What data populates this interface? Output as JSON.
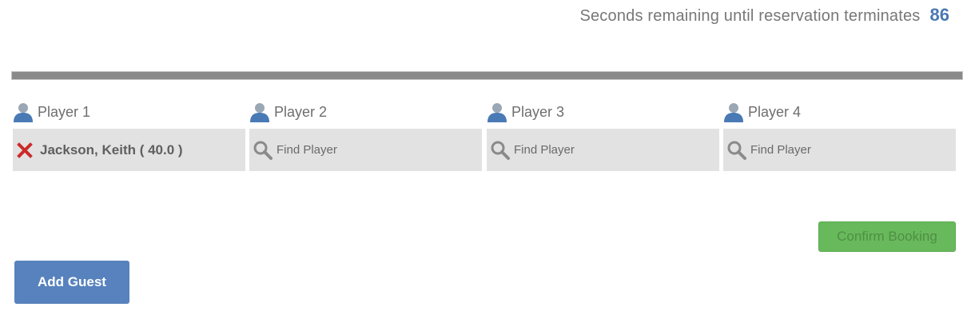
{
  "timer": {
    "label": "Seconds remaining until reservation terminates",
    "seconds": "86"
  },
  "progress": {
    "fraction_remaining": 1.0
  },
  "players": [
    {
      "label": "Player 1",
      "value": "Jackson, Keith ( 40.0 )"
    },
    {
      "label": "Player 2",
      "placeholder": "Find Player"
    },
    {
      "label": "Player 3",
      "placeholder": "Find Player"
    },
    {
      "label": "Player 4",
      "placeholder": "Find Player"
    }
  ],
  "buttons": {
    "confirm_label": "Confirm Booking",
    "add_guest_label": "Add Guest"
  },
  "colors": {
    "accent_blue": "#5782bd",
    "timer_blue": "#4a78b2",
    "confirm_green": "#68b95c",
    "remove_red": "#cc2a2a"
  },
  "icons": {
    "player": "person-icon",
    "remove": "close-icon",
    "search": "search-icon"
  }
}
